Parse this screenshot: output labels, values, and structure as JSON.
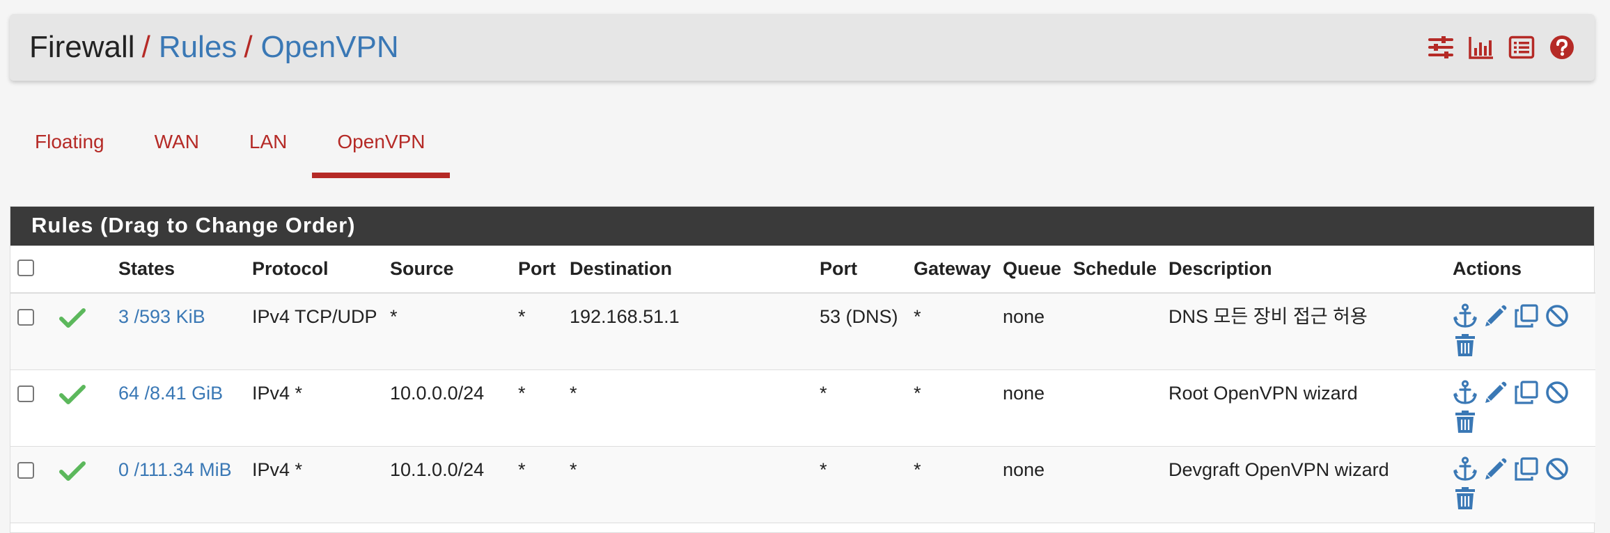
{
  "breadcrumb": {
    "root": "Firewall",
    "separator": "/",
    "rules": "Rules",
    "current": "OpenVPN"
  },
  "header_icons": [
    "sliders-icon",
    "bar-chart-icon",
    "list-icon",
    "help-icon"
  ],
  "tabs": [
    {
      "label": "Floating",
      "active": false
    },
    {
      "label": "WAN",
      "active": false
    },
    {
      "label": "LAN",
      "active": false
    },
    {
      "label": "OpenVPN",
      "active": true
    }
  ],
  "panel": {
    "title": "Rules (Drag to Change Order)",
    "columns": [
      "",
      "",
      "States",
      "Protocol",
      "Source",
      "Port",
      "Destination",
      "Port",
      "Gateway",
      "Queue",
      "Schedule",
      "Description",
      "Actions"
    ],
    "rows": [
      {
        "states": "3 /593 KiB",
        "protocol": "IPv4 TCP/UDP",
        "source": "*",
        "source_port": "*",
        "destination": "192.168.51.1",
        "dest_port": "53 (DNS)",
        "gateway": "*",
        "queue": "none",
        "schedule": "",
        "description": "DNS 모든 장비 접근 허용"
      },
      {
        "states": "64 /8.41 GiB",
        "protocol": "IPv4 *",
        "source": "10.0.0.0/24",
        "source_port": "*",
        "destination": "*",
        "dest_port": "*",
        "gateway": "*",
        "queue": "none",
        "schedule": "",
        "description": "Root OpenVPN wizard"
      },
      {
        "states": "0 /111.34 MiB",
        "protocol": "IPv4 *",
        "source": "10.1.0.0/24",
        "source_port": "*",
        "destination": "*",
        "dest_port": "*",
        "gateway": "*",
        "queue": "none",
        "schedule": "",
        "description": "Devgraft OpenVPN wizard"
      }
    ],
    "row_actions": [
      "anchor-icon",
      "pencil-icon",
      "copy-icon",
      "disable-icon",
      "trash-icon"
    ]
  },
  "colors": {
    "accent_red": "#b52a26",
    "link_blue": "#3a78b5",
    "check_green": "#5cb85c",
    "panel_heading": "#3a3a3a"
  }
}
